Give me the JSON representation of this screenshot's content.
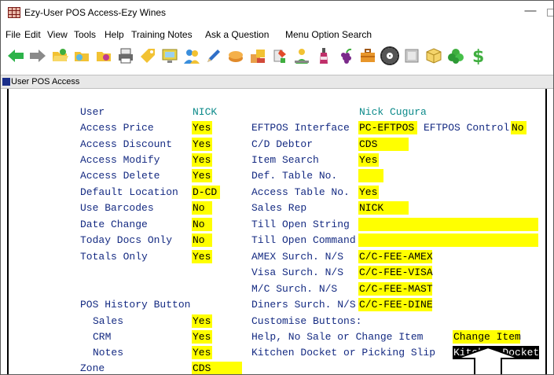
{
  "window": {
    "title": "Ezy-User POS Access-Ezy Wines",
    "min_symbol": "—"
  },
  "menu": [
    "File",
    "Edit",
    "View",
    "Tools",
    "Help",
    "Training Notes",
    "Ask a Question",
    "Menu Option Search"
  ],
  "toolbar_icons": [
    "back-arrow-icon",
    "forward-arrow-icon",
    "open-folder-icon",
    "folder-icon",
    "add-folder-icon",
    "printer-icon",
    "tag-icon",
    "monitor-icon",
    "users-icon",
    "pen-icon",
    "coin-icon",
    "boxes-icon",
    "paint-icon",
    "person-icon",
    "bottle-icon",
    "wine-icon",
    "briefcase-icon",
    "gear-icon",
    "form-icon",
    "package-icon",
    "leaf-icon",
    "dollar-icon"
  ],
  "screen_title": "User POS Access",
  "left_fields": [
    {
      "label": "User",
      "value": "NICK",
      "style": "cyan"
    },
    {
      "label": "Access Price",
      "value": "Yes"
    },
    {
      "label": "Access Discount",
      "value": "Yes"
    },
    {
      "label": "Access Modify",
      "value": "Yes"
    },
    {
      "label": "Access Delete",
      "value": "Yes"
    },
    {
      "label": "Default Location",
      "value": "D-CD"
    },
    {
      "label": "Use Barcodes",
      "value": "No"
    },
    {
      "label": "Date Change",
      "value": "No"
    },
    {
      "label": "Today Docs Only",
      "value": "No"
    },
    {
      "label": "Totals Only",
      "value": "Yes"
    }
  ],
  "user_fullname": "Nick Cugura",
  "right_fields": [
    {
      "label": "EFTPOS Interface",
      "value": "PC-EFTPOS"
    },
    {
      "label": "C/D Debtor",
      "value": "CDS"
    },
    {
      "label": "Item Search",
      "value": "Yes"
    },
    {
      "label": "Def. Table No.",
      "value": ""
    },
    {
      "label": "Access Table No.",
      "value": "Yes"
    },
    {
      "label": "Sales Rep",
      "value": "NICK"
    },
    {
      "label": "Till Open String",
      "value": ""
    },
    {
      "label": "Till Open Command",
      "value": ""
    },
    {
      "label": "AMEX Surch. N/S",
      "value": "C/C-FEE-AMEX"
    },
    {
      "label": "Visa Surch. N/S",
      "value": "C/C-FEE-VISA"
    },
    {
      "label": "M/C Surch. N/S",
      "value": "C/C-FEE-MAST"
    },
    {
      "label": "Diners Surch. N/S",
      "value": "C/C-FEE-DINE"
    }
  ],
  "eftpos_control": {
    "label": "EFTPOS Control",
    "value": "No"
  },
  "pos_history": {
    "heading": "POS History Button",
    "items": [
      {
        "label": "Sales",
        "value": "Yes"
      },
      {
        "label": "CRM",
        "value": "Yes"
      },
      {
        "label": "Notes",
        "value": "Yes"
      }
    ]
  },
  "zone": {
    "label": "Zone",
    "value": "CDS"
  },
  "customise": {
    "heading": "Customise Buttons:",
    "help_label": "Help, No Sale or Change Item",
    "help_value": "Change Item",
    "kitchen_label": "Kitchen Docket or Picking Slip",
    "kitchen_value": "Kitchen Docket"
  }
}
